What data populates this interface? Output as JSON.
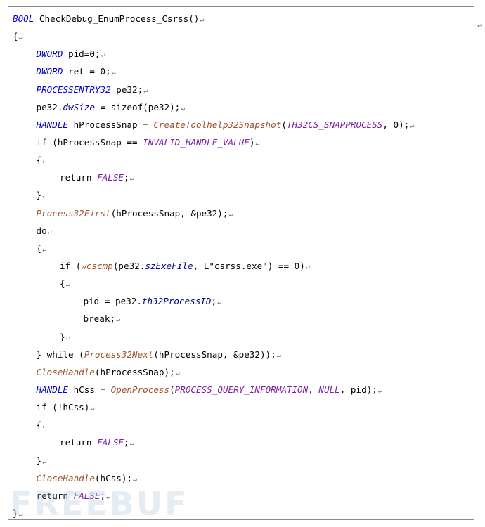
{
  "paragraph_mark": "↵",
  "watermark_text": "FREEBUF",
  "code_lines": [
    {
      "indent": 0,
      "tokens": [
        {
          "t": "ty",
          "v": "BOOL"
        },
        {
          "t": "tx",
          "v": " CheckDebug_EnumProcess_Csrss()"
        }
      ]
    },
    {
      "indent": 0,
      "tokens": [
        {
          "t": "tx",
          "v": "{"
        }
      ]
    },
    {
      "indent": 1,
      "tokens": [
        {
          "t": "ty",
          "v": "DWORD"
        },
        {
          "t": "tx",
          "v": " pid=0;"
        }
      ]
    },
    {
      "indent": 1,
      "tokens": [
        {
          "t": "ty",
          "v": "DWORD"
        },
        {
          "t": "tx",
          "v": " ret = 0;"
        }
      ]
    },
    {
      "indent": 1,
      "tokens": [
        {
          "t": "ty",
          "v": "PROCESSENTRY32"
        },
        {
          "t": "tx",
          "v": " pe32;"
        }
      ]
    },
    {
      "indent": 1,
      "tokens": [
        {
          "t": "tx",
          "v": "pe32."
        },
        {
          "t": "mb",
          "v": "dwSize"
        },
        {
          "t": "tx",
          "v": " = sizeof(pe32);"
        }
      ]
    },
    {
      "indent": 1,
      "tokens": [
        {
          "t": "ty",
          "v": "HANDLE"
        },
        {
          "t": "tx",
          "v": " hProcessSnap = "
        },
        {
          "t": "fn",
          "v": "CreateToolhelp32Snapshot"
        },
        {
          "t": "tx",
          "v": "("
        },
        {
          "t": "cn",
          "v": "TH32CS_SNAPPROCESS"
        },
        {
          "t": "tx",
          "v": ", 0);"
        }
      ]
    },
    {
      "indent": 1,
      "tokens": [
        {
          "t": "tx",
          "v": "if (hProcessSnap == "
        },
        {
          "t": "cn",
          "v": "INVALID_HANDLE_VALUE"
        },
        {
          "t": "tx",
          "v": ")"
        }
      ]
    },
    {
      "indent": 1,
      "tokens": [
        {
          "t": "tx",
          "v": "{"
        }
      ]
    },
    {
      "indent": 2,
      "tokens": [
        {
          "t": "tx",
          "v": "return "
        },
        {
          "t": "cn",
          "v": "FALSE"
        },
        {
          "t": "tx",
          "v": ";"
        }
      ]
    },
    {
      "indent": 1,
      "tokens": [
        {
          "t": "tx",
          "v": "}"
        }
      ]
    },
    {
      "indent": 1,
      "tokens": [
        {
          "t": "fn",
          "v": "Process32First"
        },
        {
          "t": "tx",
          "v": "(hProcessSnap, &pe32);"
        }
      ]
    },
    {
      "indent": 1,
      "tokens": [
        {
          "t": "tx",
          "v": "do"
        }
      ]
    },
    {
      "indent": 1,
      "tokens": [
        {
          "t": "tx",
          "v": "{"
        }
      ]
    },
    {
      "indent": 2,
      "tokens": [
        {
          "t": "tx",
          "v": "if ("
        },
        {
          "t": "fn",
          "v": "wcscmp"
        },
        {
          "t": "tx",
          "v": "(pe32."
        },
        {
          "t": "mb",
          "v": "szExeFile"
        },
        {
          "t": "tx",
          "v": ", L"
        },
        {
          "t": "st",
          "v": "\"csrss.exe\""
        },
        {
          "t": "tx",
          "v": ") == 0)"
        }
      ]
    },
    {
      "indent": 2,
      "tokens": [
        {
          "t": "tx",
          "v": "{"
        }
      ]
    },
    {
      "indent": 3,
      "tokens": [
        {
          "t": "tx",
          "v": "pid = pe32."
        },
        {
          "t": "mb",
          "v": "th32ProcessID"
        },
        {
          "t": "tx",
          "v": ";"
        }
      ]
    },
    {
      "indent": 3,
      "tokens": [
        {
          "t": "tx",
          "v": "break;"
        }
      ]
    },
    {
      "indent": 2,
      "tokens": [
        {
          "t": "tx",
          "v": "}"
        }
      ]
    },
    {
      "indent": 1,
      "tokens": [
        {
          "t": "tx",
          "v": "} while ("
        },
        {
          "t": "fn",
          "v": "Process32Next"
        },
        {
          "t": "tx",
          "v": "(hProcessSnap, &pe32));"
        }
      ]
    },
    {
      "indent": 1,
      "tokens": [
        {
          "t": "fn",
          "v": "CloseHandle"
        },
        {
          "t": "tx",
          "v": "(hProcessSnap);"
        }
      ]
    },
    {
      "indent": 1,
      "tokens": [
        {
          "t": "ty",
          "v": "HANDLE"
        },
        {
          "t": "tx",
          "v": " hCss = "
        },
        {
          "t": "fn",
          "v": "OpenProcess"
        },
        {
          "t": "tx",
          "v": "("
        },
        {
          "t": "cn",
          "v": "PROCESS_QUERY_INFORMATION"
        },
        {
          "t": "tx",
          "v": ", "
        },
        {
          "t": "cn",
          "v": "NULL"
        },
        {
          "t": "tx",
          "v": ", pid);"
        }
      ]
    },
    {
      "indent": 1,
      "tokens": [
        {
          "t": "tx",
          "v": "if (!hCss)"
        }
      ]
    },
    {
      "indent": 1,
      "tokens": [
        {
          "t": "tx",
          "v": "{"
        }
      ]
    },
    {
      "indent": 2,
      "tokens": [
        {
          "t": "tx",
          "v": "return "
        },
        {
          "t": "cn",
          "v": "FALSE"
        },
        {
          "t": "tx",
          "v": ";"
        }
      ]
    },
    {
      "indent": 1,
      "tokens": [
        {
          "t": "tx",
          "v": "}"
        }
      ]
    },
    {
      "indent": 1,
      "tokens": [
        {
          "t": "fn",
          "v": "CloseHandle"
        },
        {
          "t": "tx",
          "v": "(hCss);"
        }
      ]
    },
    {
      "indent": 1,
      "tokens": [
        {
          "t": "tx",
          "v": "return "
        },
        {
          "t": "cn",
          "v": "FALSE"
        },
        {
          "t": "tx",
          "v": ";"
        }
      ]
    },
    {
      "indent": 0,
      "tokens": [
        {
          "t": "tx",
          "v": "}"
        }
      ]
    }
  ]
}
